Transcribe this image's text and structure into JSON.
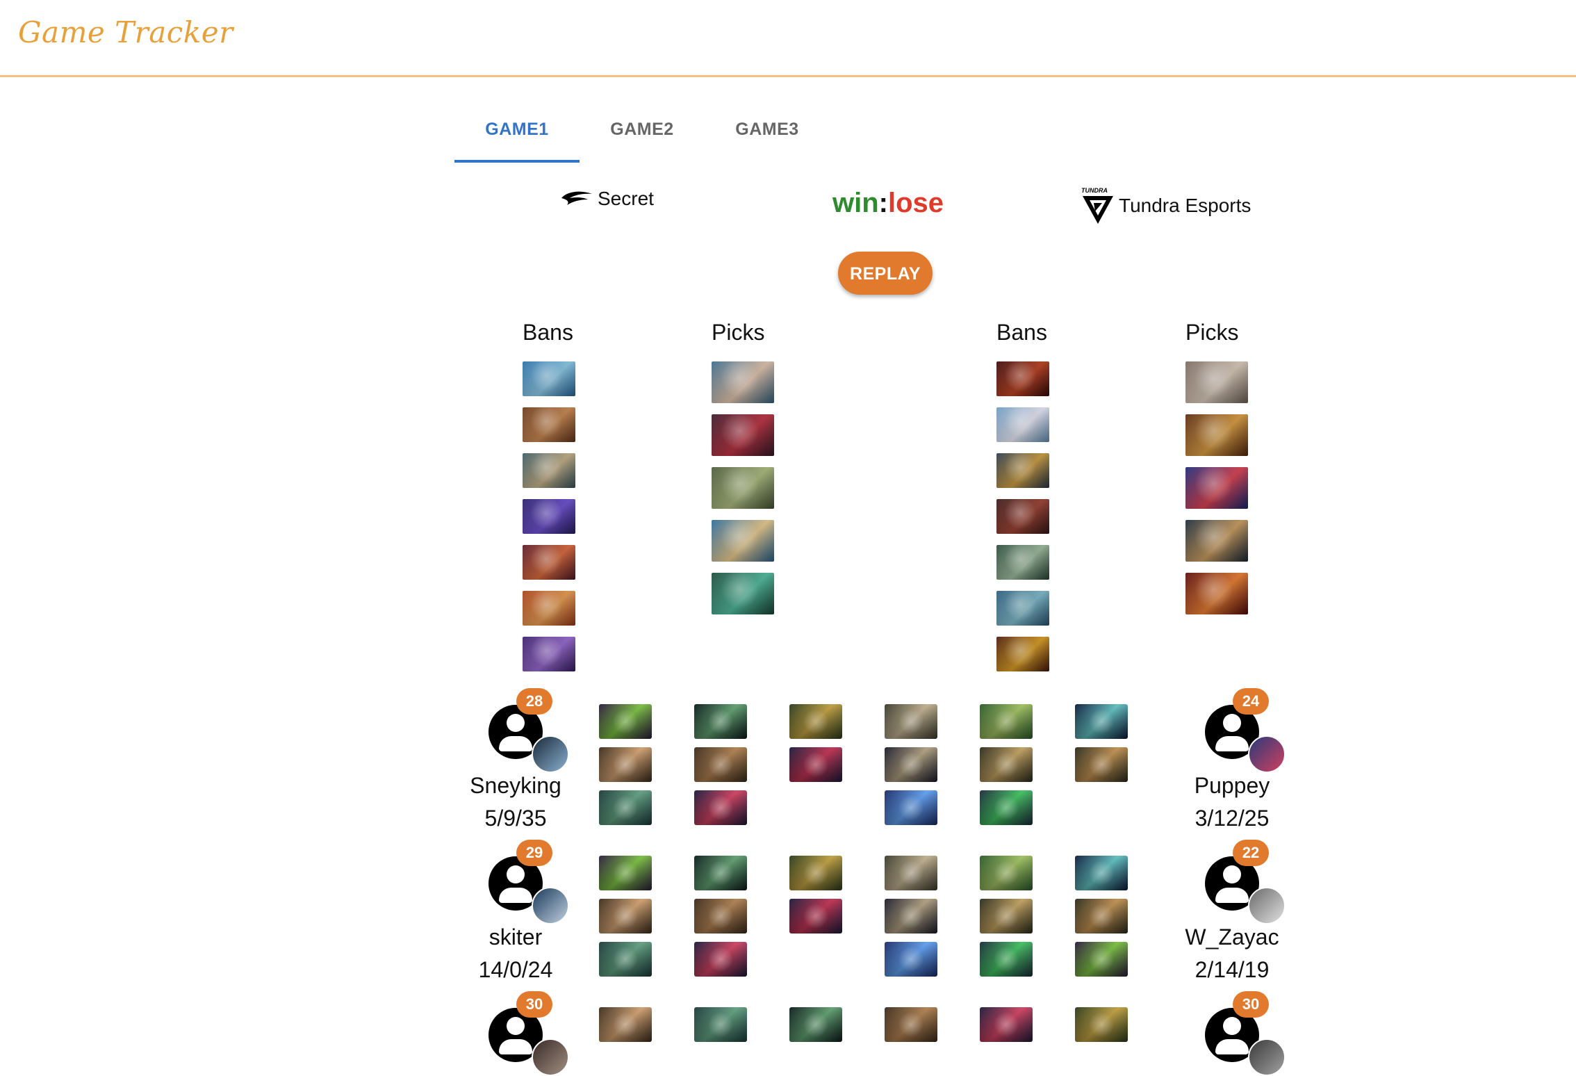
{
  "header": {
    "brand": "Game Tracker"
  },
  "tabs": [
    {
      "label": "GAME1",
      "active": true
    },
    {
      "label": "GAME2",
      "active": false
    },
    {
      "label": "GAME3",
      "active": false
    }
  ],
  "match": {
    "team_left": {
      "name": "Secret",
      "logo": "secret-logo-icon"
    },
    "team_right": {
      "name": "Tundra Esports",
      "logo": "tundra-logo-icon",
      "logo_text": "TUNDRA"
    },
    "result_win": "win",
    "result_sep": ":",
    "result_lose": "lose",
    "colors": {
      "win": "#2e8b2e",
      "lose": "#e03b2a",
      "accent": "#e27a2e",
      "tab_active": "#3474c8",
      "header_line": "#f4c27d"
    }
  },
  "replay_label": "REPLAY",
  "draft": {
    "left_bans_label": "Bans",
    "left_picks_label": "Picks",
    "right_bans_label": "Bans",
    "right_picks_label": "Picks",
    "left_bans": [
      "hero-portrait-icon",
      "hero-portrait-icon",
      "hero-portrait-icon",
      "hero-portrait-icon",
      "hero-portrait-icon",
      "hero-portrait-icon",
      "hero-portrait-icon"
    ],
    "left_picks": [
      "hero-portrait-icon",
      "hero-portrait-icon",
      "hero-portrait-icon",
      "hero-portrait-icon",
      "hero-portrait-icon"
    ],
    "right_bans": [
      "hero-portrait-icon",
      "hero-portrait-icon",
      "hero-portrait-icon",
      "hero-portrait-icon",
      "hero-portrait-icon",
      "hero-portrait-icon",
      "hero-portrait-icon"
    ],
    "right_picks": [
      "hero-portrait-icon",
      "hero-portrait-icon",
      "hero-portrait-icon",
      "hero-portrait-icon",
      "hero-portrait-icon"
    ]
  },
  "players": [
    {
      "left": {
        "name": "Sneyking",
        "kda": "5/9/35",
        "level": "28"
      },
      "right": {
        "name": "Puppey",
        "kda": "3/12/25",
        "level": "24"
      }
    },
    {
      "left": {
        "name": "skiter",
        "kda": "14/0/24",
        "level": "29"
      },
      "right": {
        "name": "W_Zayac",
        "kda": "2/14/19",
        "level": "22"
      }
    },
    {
      "left": {
        "name": "",
        "kda": "",
        "level": "30"
      },
      "right": {
        "name": "",
        "kda": "",
        "level": "30"
      }
    }
  ]
}
